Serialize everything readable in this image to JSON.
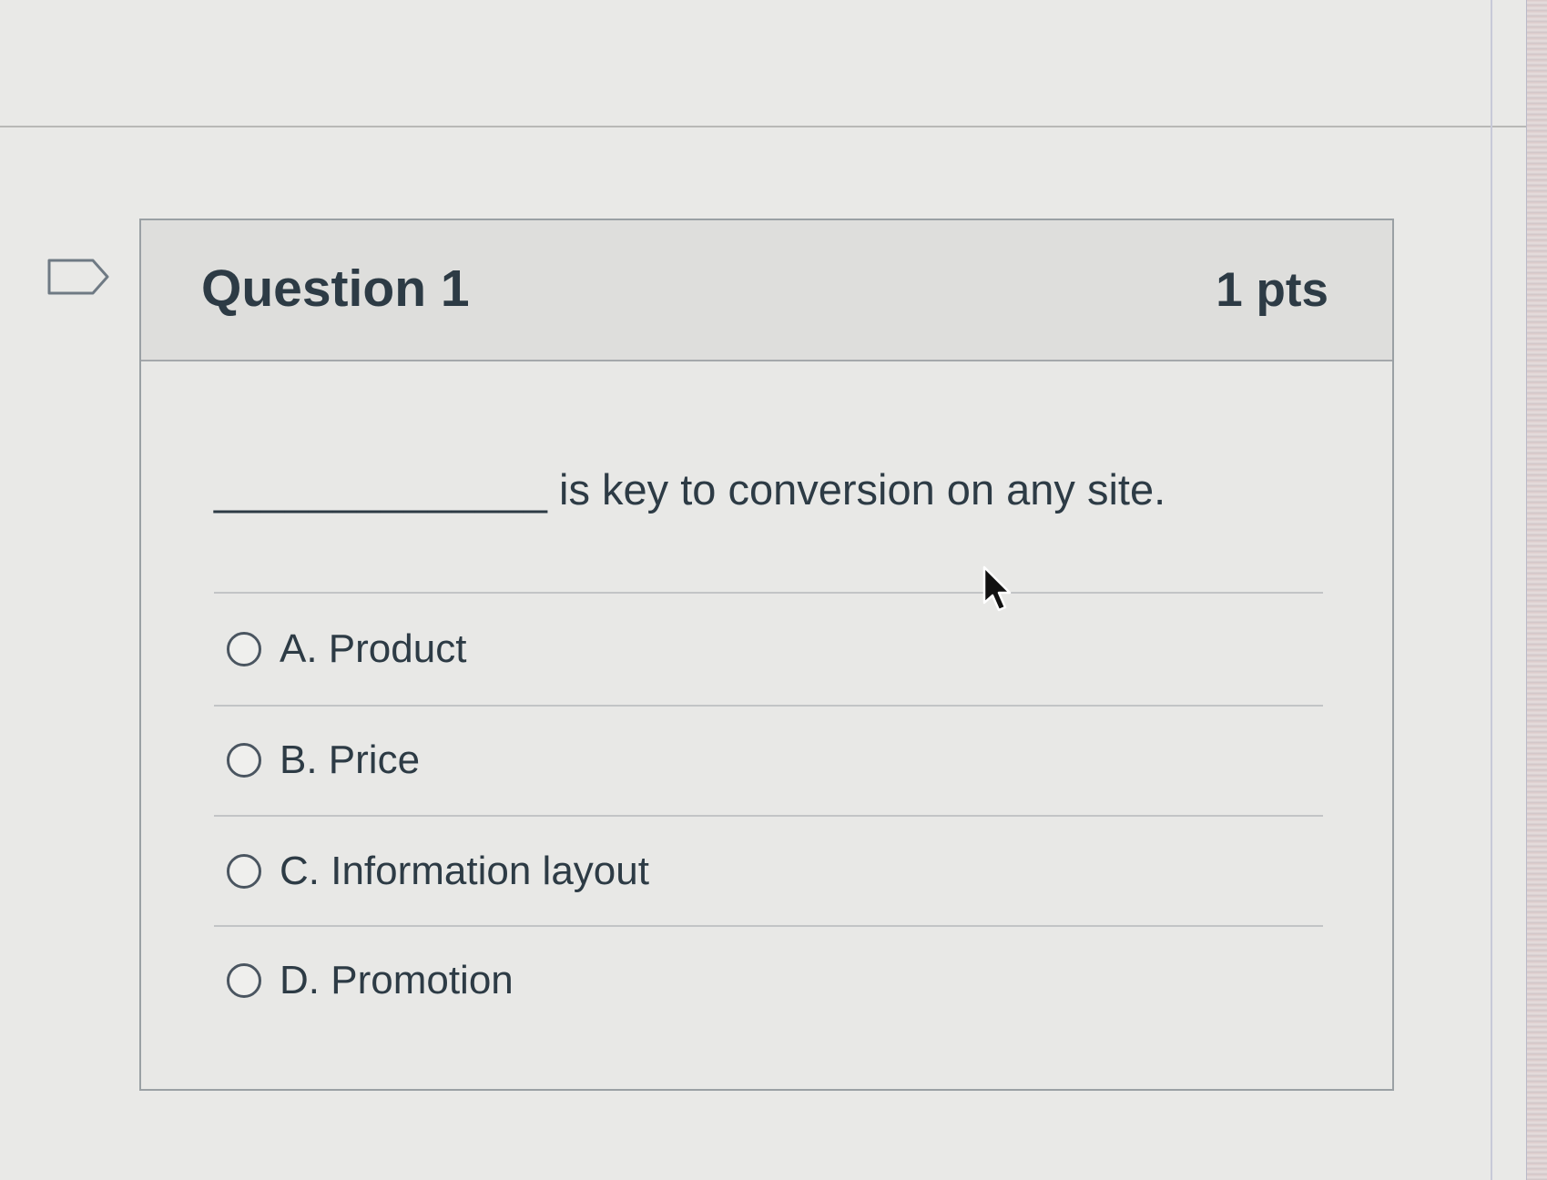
{
  "quiz": {
    "question": {
      "title": "Question 1",
      "points": "1 pts",
      "text": "______________ is key to conversion on any site.",
      "answers": [
        {
          "label": "A. Product",
          "selected": false
        },
        {
          "label": "B. Price",
          "selected": false
        },
        {
          "label": "C. Information layout",
          "selected": false
        },
        {
          "label": "D. Promotion",
          "selected": false
        }
      ]
    }
  },
  "icons": {
    "flag": "flag-question-icon",
    "cursor": "mouse-pointer-icon"
  },
  "colors": {
    "text": "#2d3b45",
    "page_background": "#e9e9e7",
    "header_background": "#dededc",
    "border": "#9aa0a4"
  }
}
